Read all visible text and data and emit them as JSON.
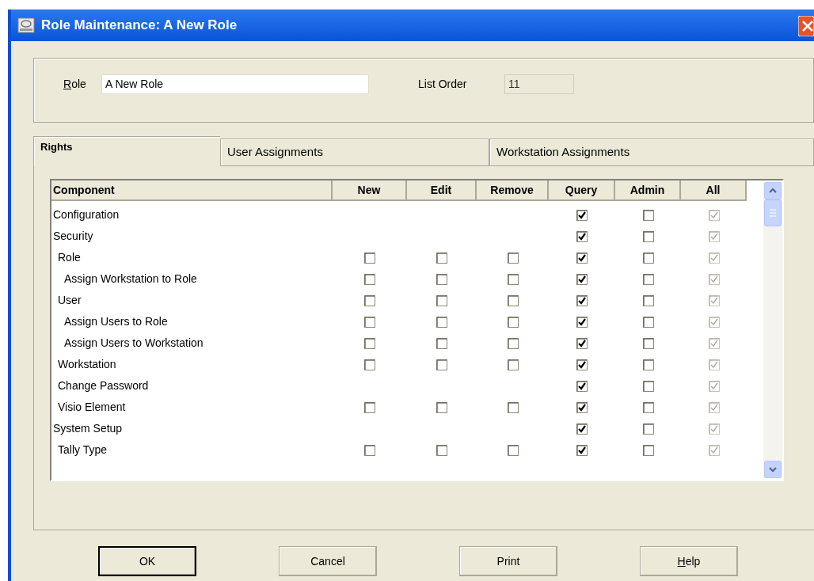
{
  "window": {
    "title": "Role Maintenance: A New Role"
  },
  "role": {
    "label": "Role",
    "underline_first": true,
    "value": "A New Role"
  },
  "list_order": {
    "label": "List Order",
    "value": "11",
    "disabled": true
  },
  "tabs": [
    {
      "label": "Rights",
      "selected": true
    },
    {
      "label": "User Assignments",
      "selected": false
    },
    {
      "label": "Workstation Assignments",
      "selected": false
    }
  ],
  "table": {
    "columns": [
      "Component",
      "New",
      "Edit",
      "Remove",
      "Query",
      "Admin",
      "All"
    ],
    "rows": [
      {
        "label": "Configuration",
        "cells": {
          "query": {
            "checked": true,
            "disabled": false
          },
          "admin": {
            "checked": false,
            "disabled": false
          },
          "all": {
            "checked": true,
            "disabled": true
          }
        }
      },
      {
        "label": "Security",
        "cells": {
          "query": {
            "checked": true,
            "disabled": false
          },
          "admin": {
            "checked": false,
            "disabled": false
          },
          "all": {
            "checked": true,
            "disabled": true
          }
        },
        "children": [
          {
            "label": "Role",
            "cells": {
              "new": {
                "checked": false,
                "disabled": false
              },
              "edit": {
                "checked": false,
                "disabled": false
              },
              "remove": {
                "checked": false,
                "disabled": false
              },
              "query": {
                "checked": true,
                "disabled": false
              },
              "admin": {
                "checked": false,
                "disabled": false
              },
              "all": {
                "checked": true,
                "disabled": true
              }
            },
            "children": [
              {
                "label": "Assign Workstation to Role",
                "cells": {
                  "new": {
                    "checked": false,
                    "disabled": false
                  },
                  "edit": {
                    "checked": false,
                    "disabled": false
                  },
                  "remove": {
                    "checked": false,
                    "disabled": false
                  },
                  "query": {
                    "checked": true,
                    "disabled": false
                  },
                  "admin": {
                    "checked": false,
                    "disabled": false
                  },
                  "all": {
                    "checked": true,
                    "disabled": true
                  }
                }
              }
            ]
          },
          {
            "label": "User",
            "cells": {
              "new": {
                "checked": false,
                "disabled": false
              },
              "edit": {
                "checked": false,
                "disabled": false
              },
              "remove": {
                "checked": false,
                "disabled": false
              },
              "query": {
                "checked": true,
                "disabled": false
              },
              "admin": {
                "checked": false,
                "disabled": false
              },
              "all": {
                "checked": true,
                "disabled": true
              }
            },
            "children": [
              {
                "label": "Assign Users to Role",
                "cells": {
                  "new": {
                    "checked": false,
                    "disabled": false
                  },
                  "edit": {
                    "checked": false,
                    "disabled": false
                  },
                  "remove": {
                    "checked": false,
                    "disabled": false
                  },
                  "query": {
                    "checked": true,
                    "disabled": false
                  },
                  "admin": {
                    "checked": false,
                    "disabled": false
                  },
                  "all": {
                    "checked": true,
                    "disabled": true
                  }
                }
              },
              {
                "label": "Assign Users to Workstation",
                "cells": {
                  "new": {
                    "checked": false,
                    "disabled": false
                  },
                  "edit": {
                    "checked": false,
                    "disabled": false
                  },
                  "remove": {
                    "checked": false,
                    "disabled": false
                  },
                  "query": {
                    "checked": true,
                    "disabled": false
                  },
                  "admin": {
                    "checked": false,
                    "disabled": false
                  },
                  "all": {
                    "checked": true,
                    "disabled": true
                  }
                }
              }
            ]
          },
          {
            "label": "Workstation",
            "cells": {
              "new": {
                "checked": false,
                "disabled": false
              },
              "edit": {
                "checked": false,
                "disabled": false
              },
              "remove": {
                "checked": false,
                "disabled": false
              },
              "query": {
                "checked": true,
                "disabled": false
              },
              "admin": {
                "checked": false,
                "disabled": false
              },
              "all": {
                "checked": true,
                "disabled": true
              }
            }
          },
          {
            "label": "Change Password",
            "cells": {
              "query": {
                "checked": true,
                "disabled": false
              },
              "admin": {
                "checked": false,
                "disabled": false
              },
              "all": {
                "checked": true,
                "disabled": true
              }
            }
          },
          {
            "label": "Visio Element",
            "cells": {
              "new": {
                "checked": false,
                "disabled": false
              },
              "edit": {
                "checked": false,
                "disabled": false
              },
              "remove": {
                "checked": false,
                "disabled": false
              },
              "query": {
                "checked": true,
                "disabled": false
              },
              "admin": {
                "checked": false,
                "disabled": false
              },
              "all": {
                "checked": true,
                "disabled": true
              }
            }
          }
        ]
      },
      {
        "label": "System Setup",
        "cells": {
          "query": {
            "checked": true,
            "disabled": false
          },
          "admin": {
            "checked": false,
            "disabled": false
          },
          "all": {
            "checked": true,
            "disabled": true
          }
        },
        "children": [
          {
            "label": "Tally Type",
            "cells": {
              "new": {
                "checked": false,
                "disabled": false
              },
              "edit": {
                "checked": false,
                "disabled": false
              },
              "remove": {
                "checked": false,
                "disabled": false
              },
              "query": {
                "checked": true,
                "disabled": false
              },
              "admin": {
                "checked": false,
                "disabled": false
              },
              "all": {
                "checked": true,
                "disabled": true
              }
            }
          }
        ]
      }
    ]
  },
  "buttons": [
    {
      "label": "OK",
      "default": true,
      "underline_first": false
    },
    {
      "label": "Cancel",
      "default": false,
      "underline_first": false
    },
    {
      "label": "Print",
      "default": false,
      "underline_first": false
    },
    {
      "label": "Help",
      "default": false,
      "underline_first": true
    }
  ]
}
